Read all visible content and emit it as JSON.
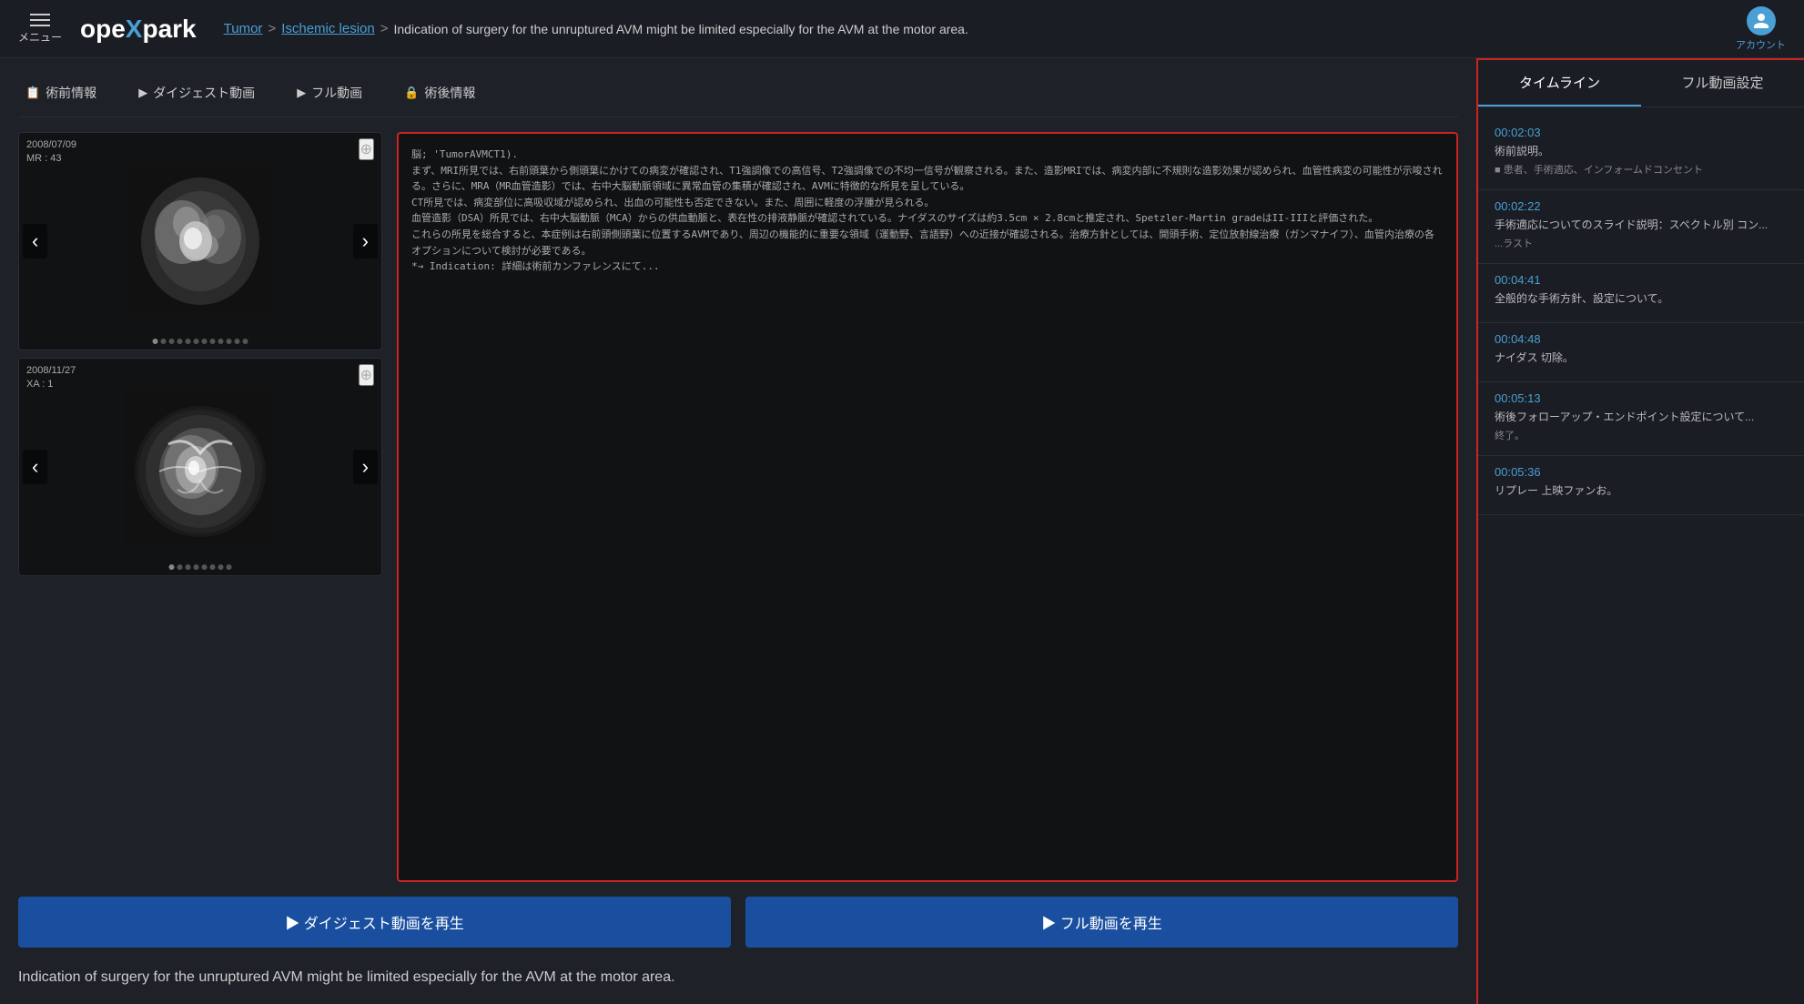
{
  "header": {
    "menu_label": "メニュー",
    "logo": "opeXpark",
    "breadcrumb": {
      "item1": "Tumor",
      "item2": "Ischemic lesion",
      "description": "Indication of surgery for the unruptured AVM might be limited especially for the AVM at the motor area."
    },
    "account_label": "アカウント"
  },
  "tabs": [
    {
      "icon": "📋",
      "label": "術前情報"
    },
    {
      "icon": "▶",
      "label": "ダイジェスト動画"
    },
    {
      "icon": "▶",
      "label": "フル動画"
    },
    {
      "icon": "🔒",
      "label": "術後情報"
    }
  ],
  "image_panels": [
    {
      "date": "2008/07/09",
      "meta2": "MR : 43",
      "dots_count": 12
    },
    {
      "date": "2008/11/27",
      "meta2": "XA : 1",
      "dots_count": 8
    }
  ],
  "note_text": "脳; 'TumorAVMCT1).\nまず、MRI所見では、右前頭葉から側頭葉にかけての病変が確認され、T1強調像での高信号、T2強調像での不均一信号が観察される。また、造影MRIでは、病変内部に不規則な造影効果が認められ、血管性病変の可能性が示唆される。さらに、MRA（MR血管造影）では、右中大脳動脈領域に異常血管の集積が確認され、AVMに特徴的な所見を呈している。\nCT所見では、病変部位に高吸収域が認められ、出血の可能性も否定できない。また、周囲に軽度の浮腫が見られる。\n血管造影（DSA）所見では、右中大脳動脈（MCA）からの供血動脈と、表在性の排液静脈が確認されている。ナイダスのサイズは約3.5cm × 2.8cmと推定され、Spetzler-Martin gradeはII-IIIと評価された。\nこれらの所見を総合すると、本症例は右前頭側頭葉に位置するAVMであり、周辺の機能的に重要な領域（運動野、言語野）への近接が確認される。治療方針としては、開頭手術、定位放射線治療（ガンマナイフ）、血管内治療の各オプションについて検討が必要である。\n*→ Indication: 詳細は術前カンファレンスにて...",
  "play_buttons": {
    "digest": "▶  ダイジェスト動画を再生",
    "full": "▶  フル動画を再生"
  },
  "description": "Indication of surgery for the unruptured AVM might be limited especially for the AVM at the motor area.",
  "sidebar": {
    "tab1": "タイムライン",
    "tab2": "フル動画設定",
    "items": [
      {
        "time": "00:02:03",
        "desc": "術前説明。",
        "sub": "■ 患者、手術適応、インフォームドコンセント"
      },
      {
        "time": "00:02:22",
        "desc": "手術適応についてのスライド説明：スペクトル別 コン...",
        "sub": "...ラスト"
      },
      {
        "time": "00:04:41",
        "desc": "全般的な手術方針、設定について。",
        "sub": ""
      },
      {
        "time": "00:04:48",
        "desc": "ナイダス 切除。",
        "sub": ""
      },
      {
        "time": "00:05:13",
        "desc": "術後フォローアップ・エンドポイント設定について...",
        "sub": "終了。"
      },
      {
        "time": "00:05:36",
        "desc": "リプレー 上映ファンお。",
        "sub": ""
      }
    ]
  }
}
